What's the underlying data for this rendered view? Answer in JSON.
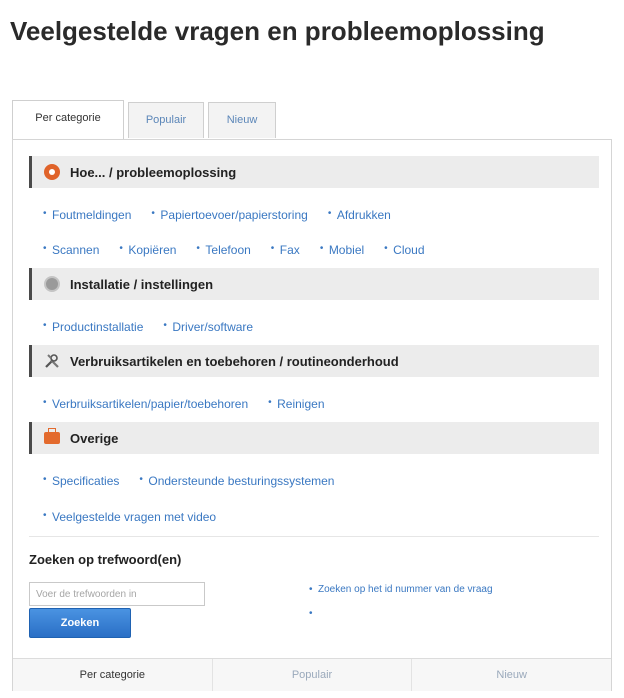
{
  "page": {
    "title": "Veelgestelde vragen en probleemoplossing"
  },
  "tabs": [
    {
      "label": "Per categorie",
      "active": true
    },
    {
      "label": "Populair",
      "active": false
    },
    {
      "label": "Nieuw",
      "active": false
    }
  ],
  "categories": [
    {
      "title": "Hoe... / probleemoplossing",
      "icon": "circle-orange-icon",
      "link_rows": [
        [
          "Foutmeldingen",
          "Papiertoevoer/papierstoring",
          "Afdrukken"
        ],
        [
          "Scannen",
          "Kopiëren",
          "Telefoon",
          "Fax",
          "Mobiel",
          "Cloud"
        ]
      ]
    },
    {
      "title": "Installatie / instellingen",
      "icon": "gear-icon",
      "link_rows": [
        [
          "Productinstallatie",
          "Driver/software"
        ]
      ]
    },
    {
      "title": "Verbruiksartikelen en toebehoren / routineonderhoud",
      "icon": "tools-icon",
      "link_rows": [
        [
          "Verbruiksartikelen/papier/toebehoren",
          "Reinigen"
        ]
      ]
    },
    {
      "title": "Overige",
      "icon": "briefcase-icon",
      "link_rows": [
        [
          "Specificaties",
          "Ondersteunde besturingssystemen"
        ],
        [
          "Veelgestelde vragen met video"
        ]
      ]
    }
  ],
  "search": {
    "label": "Zoeken op trefwoord(en)",
    "placeholder": "Voer de trefwoorden in",
    "button_label": "Zoeken",
    "aside_link": "Zoeken op het id nummer van de vraag",
    "aside_bullet": "•"
  },
  "bottom_nav": [
    {
      "label": "Per categorie",
      "active": true
    },
    {
      "label": "Populair",
      "active": false
    },
    {
      "label": "Nieuw",
      "active": false
    }
  ],
  "colors": {
    "link": "#3a78c2",
    "accent_orange": "#e0632a",
    "button": "#2a6fc6"
  }
}
